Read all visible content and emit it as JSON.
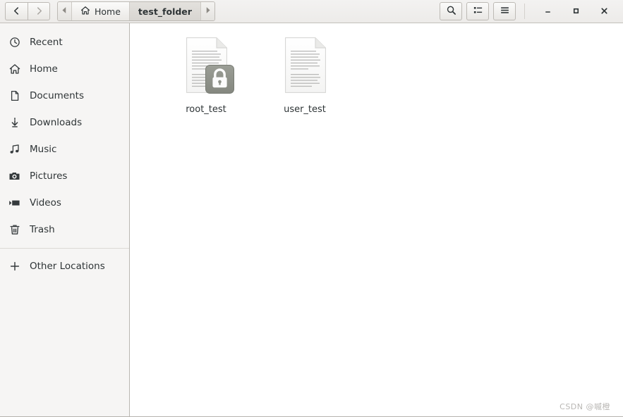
{
  "window": {
    "nav": {
      "back_icon": "chevron-left-icon",
      "forward_icon": "chevron-right-icon",
      "back_enabled": true,
      "forward_enabled": false
    },
    "pathbar": {
      "scroll_left_icon": "triangle-left-icon",
      "scroll_right_icon": "triangle-right-icon",
      "crumbs": [
        {
          "label": "Home",
          "icon": "home-icon",
          "current": false
        },
        {
          "label": "test_folder",
          "icon": "",
          "current": true
        }
      ]
    },
    "toolbar": [
      {
        "name": "search-button",
        "icon": "search-icon"
      },
      {
        "name": "view-options-button",
        "icon": "list-view-icon"
      },
      {
        "name": "main-menu-button",
        "icon": "hamburger-menu-icon"
      }
    ],
    "controls": [
      {
        "name": "minimize-button",
        "icon": "minimize-icon",
        "glyph": "–"
      },
      {
        "name": "maximize-button",
        "icon": "maximize-icon",
        "glyph": "▫"
      },
      {
        "name": "close-button",
        "icon": "close-icon",
        "glyph": "✕"
      }
    ]
  },
  "sidebar": {
    "items": [
      {
        "label": "Recent",
        "icon": "clock-icon"
      },
      {
        "label": "Home",
        "icon": "home-icon"
      },
      {
        "label": "Documents",
        "icon": "document-icon"
      },
      {
        "label": "Downloads",
        "icon": "download-icon"
      },
      {
        "label": "Music",
        "icon": "music-note-icon"
      },
      {
        "label": "Pictures",
        "icon": "camera-icon"
      },
      {
        "label": "Videos",
        "icon": "video-icon"
      },
      {
        "label": "Trash",
        "icon": "trash-icon"
      }
    ],
    "other_locations": {
      "label": "Other Locations",
      "icon": "plus-icon"
    }
  },
  "content": {
    "files": [
      {
        "name": "root_test",
        "icon": "text-document-icon",
        "emblem": "lock-icon",
        "locked": true
      },
      {
        "name": "user_test",
        "icon": "text-document-icon",
        "emblem": "",
        "locked": false
      }
    ]
  },
  "watermark": {
    "text": "CSDN @嘁橙"
  },
  "colors": {
    "headerbar_top": "#f3f2f1",
    "headerbar_bottom": "#edebe9",
    "sidebar_bg": "#f6f5f4",
    "content_bg": "#ffffff",
    "text": "#2e3436",
    "border": "#bdbab5",
    "emblem_bg": "#8d9089",
    "watermark": "#b9b7b4"
  }
}
